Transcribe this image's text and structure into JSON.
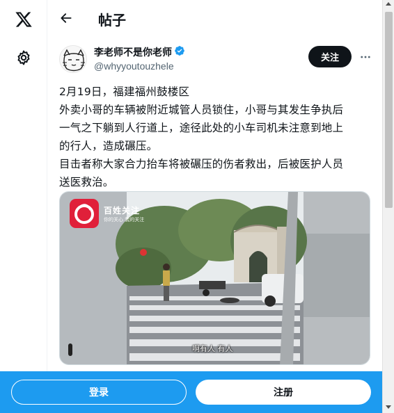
{
  "nav": {
    "logo_icon": "x-logo-icon",
    "settings_icon": "gear-icon"
  },
  "header": {
    "back_icon": "arrow-left-icon",
    "title": "帖子"
  },
  "post": {
    "author": {
      "display_name": "李老师不是你老师",
      "verified": true,
      "handle": "@whyyoutouzhele"
    },
    "follow_label": "关注",
    "more_icon": "more-horizontal-icon",
    "text_lines": [
      "2月19日，福建福州鼓楼区",
      "外卖小哥的车辆被附近城管人员锁住，小哥与其发生争执后",
      "一气之下躺到人行道上，途径此处的小车司机未注意到地上",
      "的行人，造成碾压。",
      "目击者称大家合力抬车将被碾压的伤者救出，后被医护人员",
      "送医救治。"
    ],
    "media": {
      "watermark_title": "百姓关注",
      "watermark_sub": "你的关心 我的关注",
      "subtitle": "啊有人 有人"
    }
  },
  "bottom_bar": {
    "login_label": "登录",
    "signup_label": "注册"
  },
  "colors": {
    "brand_blue": "#1d9bf0",
    "text": "#0f1419",
    "secondary": "#536471"
  }
}
